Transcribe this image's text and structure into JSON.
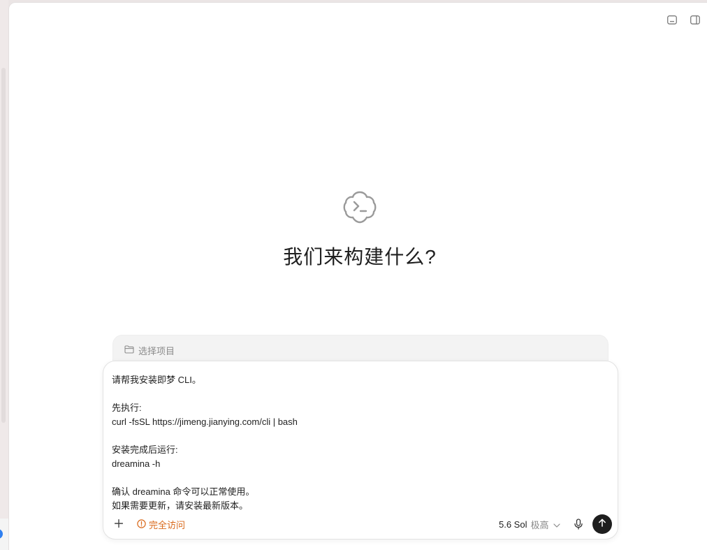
{
  "header": {
    "icons": [
      "panel-bottom-icon",
      "panel-right-icon"
    ]
  },
  "hero": {
    "logo_icon": "terminal-cloud-icon",
    "headline": "我们来构建什么?"
  },
  "project_selector": {
    "icon": "folder-icon",
    "label": "选择项目"
  },
  "composer": {
    "prompt_lines": [
      "请帮我安装即梦 CLI。",
      "",
      "先执行:",
      "curl -fsSL https://jimeng.jianying.com/cli | bash",
      "",
      "安装完成后运行:",
      "dreamina -h",
      "",
      "确认 dreamina 命令可以正常使用。",
      "如果需要更新，请安装最新版本。"
    ],
    "toolbar": {
      "add_icon": "plus-icon",
      "access_icon": "warning-circle-icon",
      "access_label": "完全访问",
      "model_name": "5.6 Sol",
      "model_level": "极高",
      "chevron_icon": "chevron-down-icon",
      "mic_icon": "microphone-icon",
      "send_icon": "arrow-up-icon"
    }
  },
  "colors": {
    "accent_warning": "#d9691b",
    "send_button": "#1e1e1e",
    "sidebar_dot": "#2f7ff0"
  }
}
